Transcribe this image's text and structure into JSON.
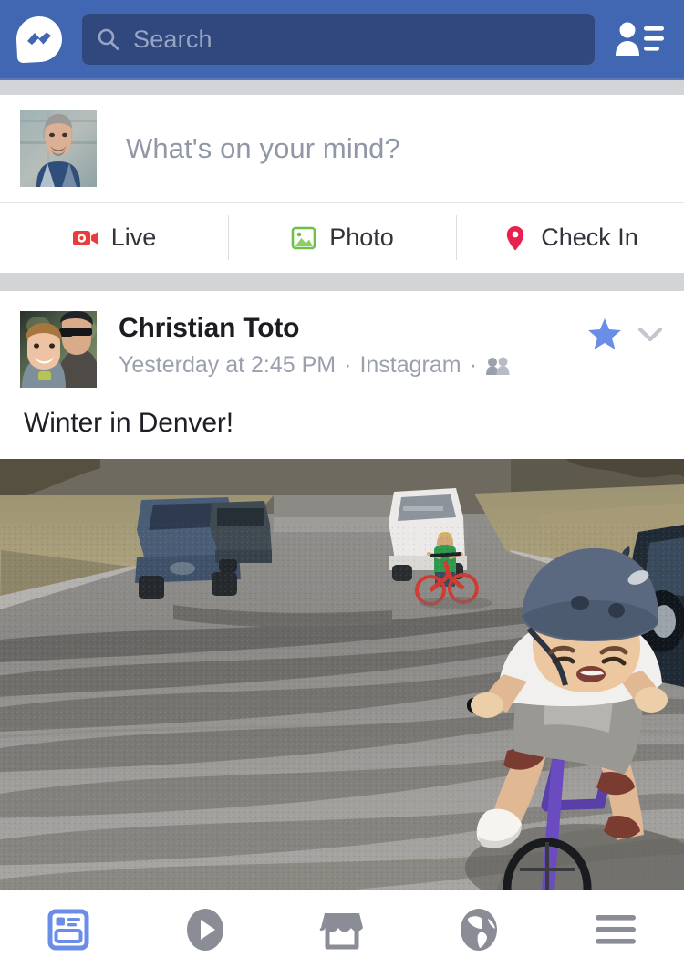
{
  "header": {
    "messenger_icon": "messenger-logo-icon",
    "search": {
      "placeholder": "Search",
      "value": "",
      "icon": "search-icon"
    },
    "contacts_icon": "contacts-list-icon",
    "bg_color": "#4267b2",
    "search_bg_color": "#31487e"
  },
  "composer": {
    "avatar": "user-avatar",
    "prompt": "What's on your mind?",
    "actions": [
      {
        "label": "Live",
        "icon": "live-video-icon",
        "color": "#ec3b3b"
      },
      {
        "label": "Photo",
        "icon": "photo-icon",
        "color": "#6fbf4b"
      },
      {
        "label": "Check In",
        "icon": "location-pin-icon",
        "color": "#e9214f"
      }
    ]
  },
  "post": {
    "avatar": "author-avatar",
    "author": "Christian Toto",
    "meta": {
      "time": "Yesterday at 2:45 PM",
      "separator": "·",
      "source": "Instagram",
      "audience_icon": "friends-audience-icon"
    },
    "star_icon": "favorite-star-icon",
    "star_color": "#6a8de8",
    "menu_icon": "chevron-down-icon",
    "text": "Winter in Denver!",
    "image_alt": "Boy riding purple bicycle down suburban street in winter, second child on red bike in distance"
  },
  "bottom_nav": {
    "active_color": "#6a8de8",
    "inactive_color": "#8a8d96",
    "tabs": [
      {
        "name": "news-feed",
        "icon": "news-feed-icon",
        "active": true
      },
      {
        "name": "watch",
        "icon": "play-circle-icon",
        "active": false
      },
      {
        "name": "marketplace",
        "icon": "marketplace-store-icon",
        "active": false
      },
      {
        "name": "notifications",
        "icon": "globe-icon",
        "active": false
      },
      {
        "name": "menu",
        "icon": "hamburger-menu-icon",
        "active": false
      }
    ]
  }
}
